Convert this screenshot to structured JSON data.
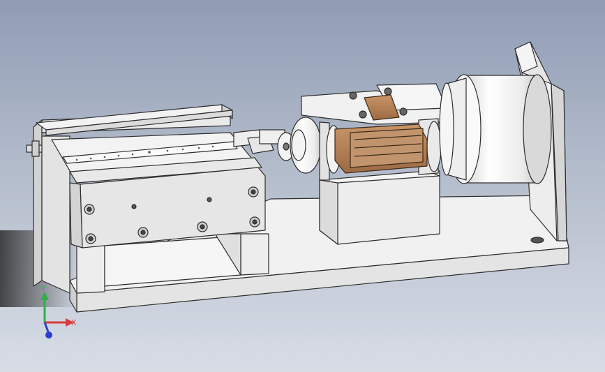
{
  "viewport": {
    "background_top": "#8f9cb4",
    "background_bottom": "#d8dde6"
  },
  "model": {
    "parts": [
      {
        "name": "base-plate",
        "color": "#efefef"
      },
      {
        "name": "linear-slide-stage",
        "color": "#e9e9e9"
      },
      {
        "name": "shaft-coupling",
        "color": "#f0f0f0"
      },
      {
        "name": "bearing-housing",
        "color": "#ececec"
      },
      {
        "name": "copper-block",
        "color": "#b98459"
      },
      {
        "name": "motor-drum",
        "color": "#f2f2f2"
      },
      {
        "name": "motor-mount-bracket",
        "color": "#ededed"
      }
    ]
  },
  "triad": {
    "y_label": "Y",
    "x_label": "X",
    "y_color": "#2fb04a",
    "x_color": "#d83a3a",
    "z_color": "#2a3fd0"
  }
}
